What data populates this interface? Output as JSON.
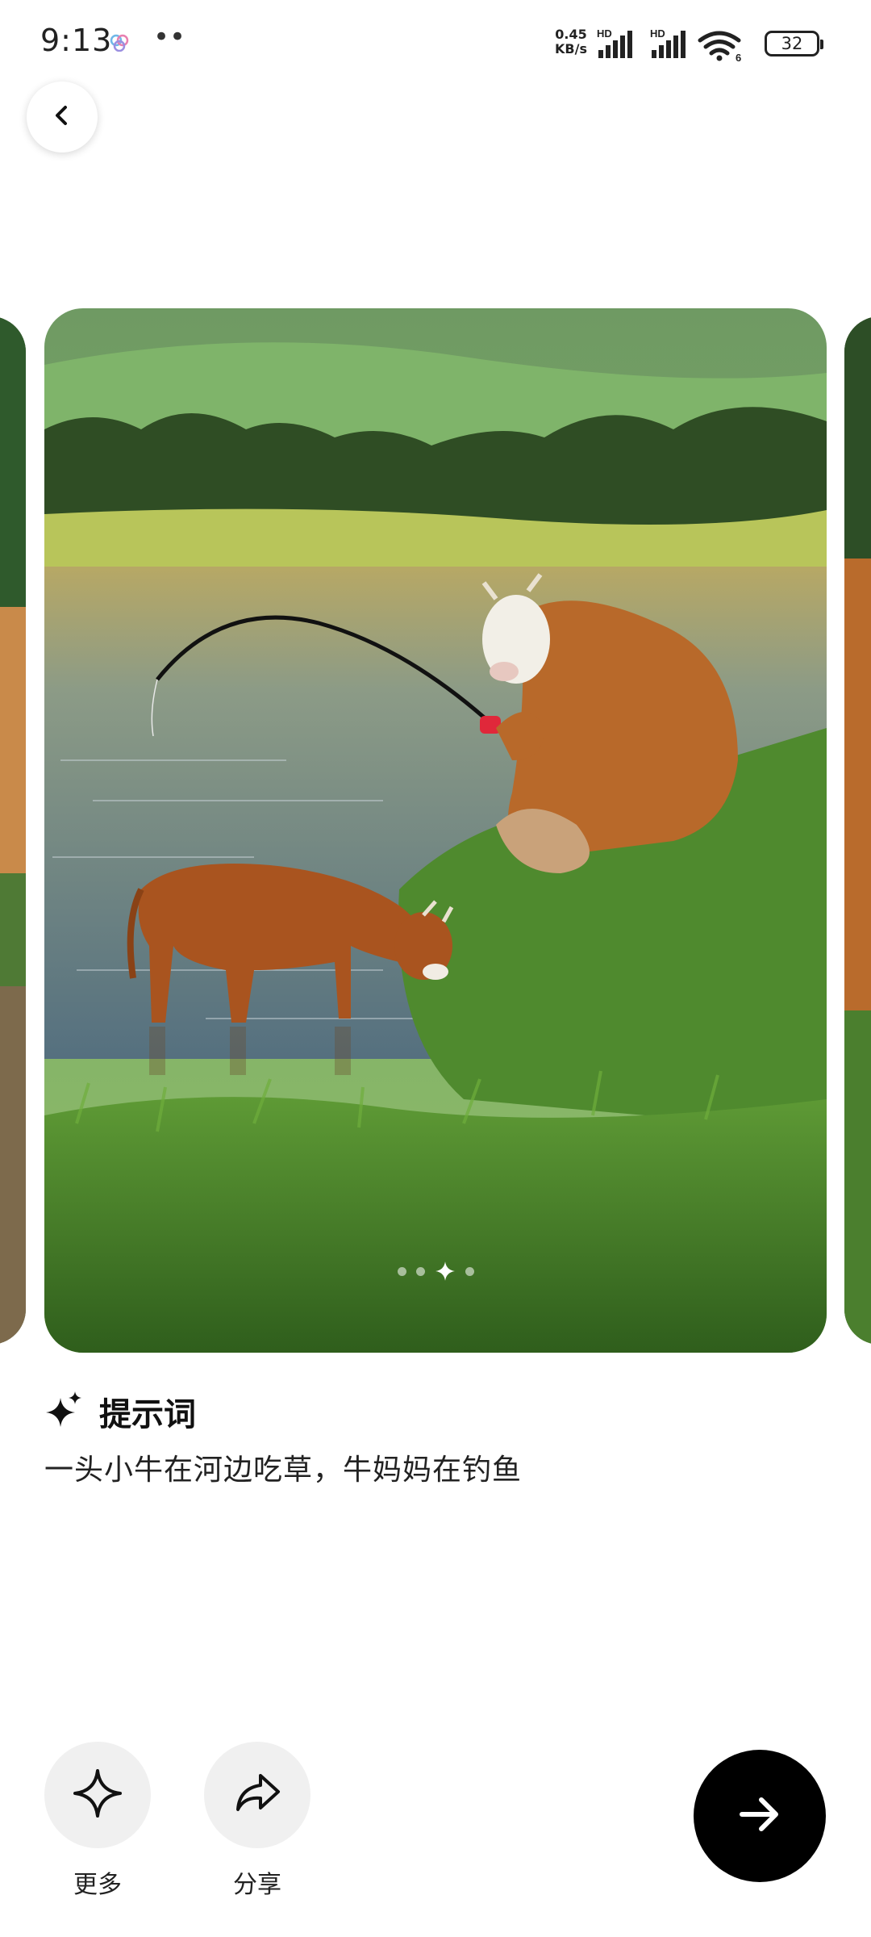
{
  "status_bar": {
    "time": "9:13",
    "dots": "••",
    "net_speed_value": "0.45",
    "net_speed_unit": "KB/s",
    "signal_1_label": "HD",
    "signal_2_label": "HD",
    "wifi_label": "6",
    "battery": "32"
  },
  "carousel": {
    "page_count": 4,
    "active_index": 2
  },
  "prompt": {
    "title": "提示词",
    "text": "一头小牛在河边吃草，牛妈妈在钓鱼"
  },
  "actions": {
    "more_label": "更多",
    "share_label": "分享"
  },
  "icons": {
    "back": "chevron-left-icon",
    "sparkle": "sparkle-icon",
    "more": "four-point-star-icon",
    "share": "share-arrow-icon",
    "next": "arrow-right-icon"
  },
  "colors": {
    "accent": "#000000",
    "action_bg": "#f0f0f0"
  }
}
